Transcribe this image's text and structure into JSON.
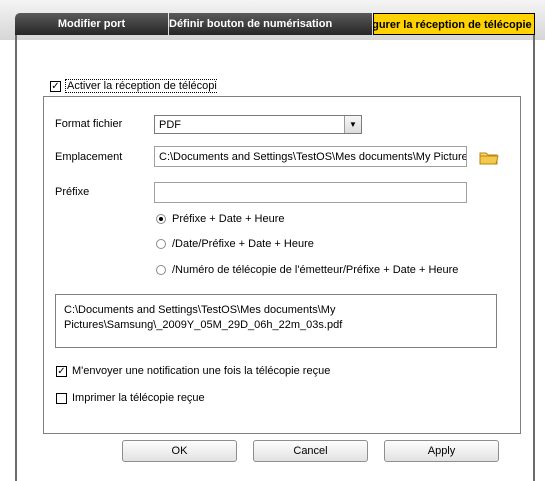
{
  "tabs": [
    {
      "label": "Modifier port",
      "active": false
    },
    {
      "label": "Définir bouton de numérisation",
      "active": false
    },
    {
      "label": "Configurer la réception de télécopie",
      "active": true
    }
  ],
  "enable_fax_receive": {
    "label": "Activer la réception de télécopie",
    "checked": true
  },
  "form": {
    "format_label": "Format fichier",
    "format_value": "PDF",
    "location_label": "Emplacement",
    "location_value": "C:\\Documents and Settings\\TestOS\\Mes documents\\My Pictures",
    "prefix_label": "Préfixe",
    "prefix_value": "",
    "radio_options": [
      {
        "label": "Préfixe + Date + Heure",
        "selected": true
      },
      {
        "label": "/Date/Préfixe + Date + Heure",
        "selected": false
      },
      {
        "label": "/Numéro de télécopie de l'émetteur/Préfixe + Date + Heure",
        "selected": false
      }
    ],
    "preview_path_line1": "C:\\Documents and Settings\\TestOS\\Mes documents\\My",
    "preview_path_line2": "Pictures\\Samsung\\_2009Y_05M_29D_06h_22m_03s.pdf"
  },
  "notify_option": {
    "label": "M'envoyer une notification une fois la télécopie reçue",
    "checked": true
  },
  "print_option": {
    "label": "Imprimer la télécopie reçue",
    "checked": false
  },
  "buttons": {
    "ok": "OK",
    "cancel": "Cancel",
    "apply": "Apply"
  },
  "icons": {
    "folder": "folder-icon",
    "dropdown": "chevron-down-icon"
  },
  "colors": {
    "active_tab": "#ffd200",
    "tab_dark": "#3a3a3a",
    "folder": "#f2c94c"
  }
}
